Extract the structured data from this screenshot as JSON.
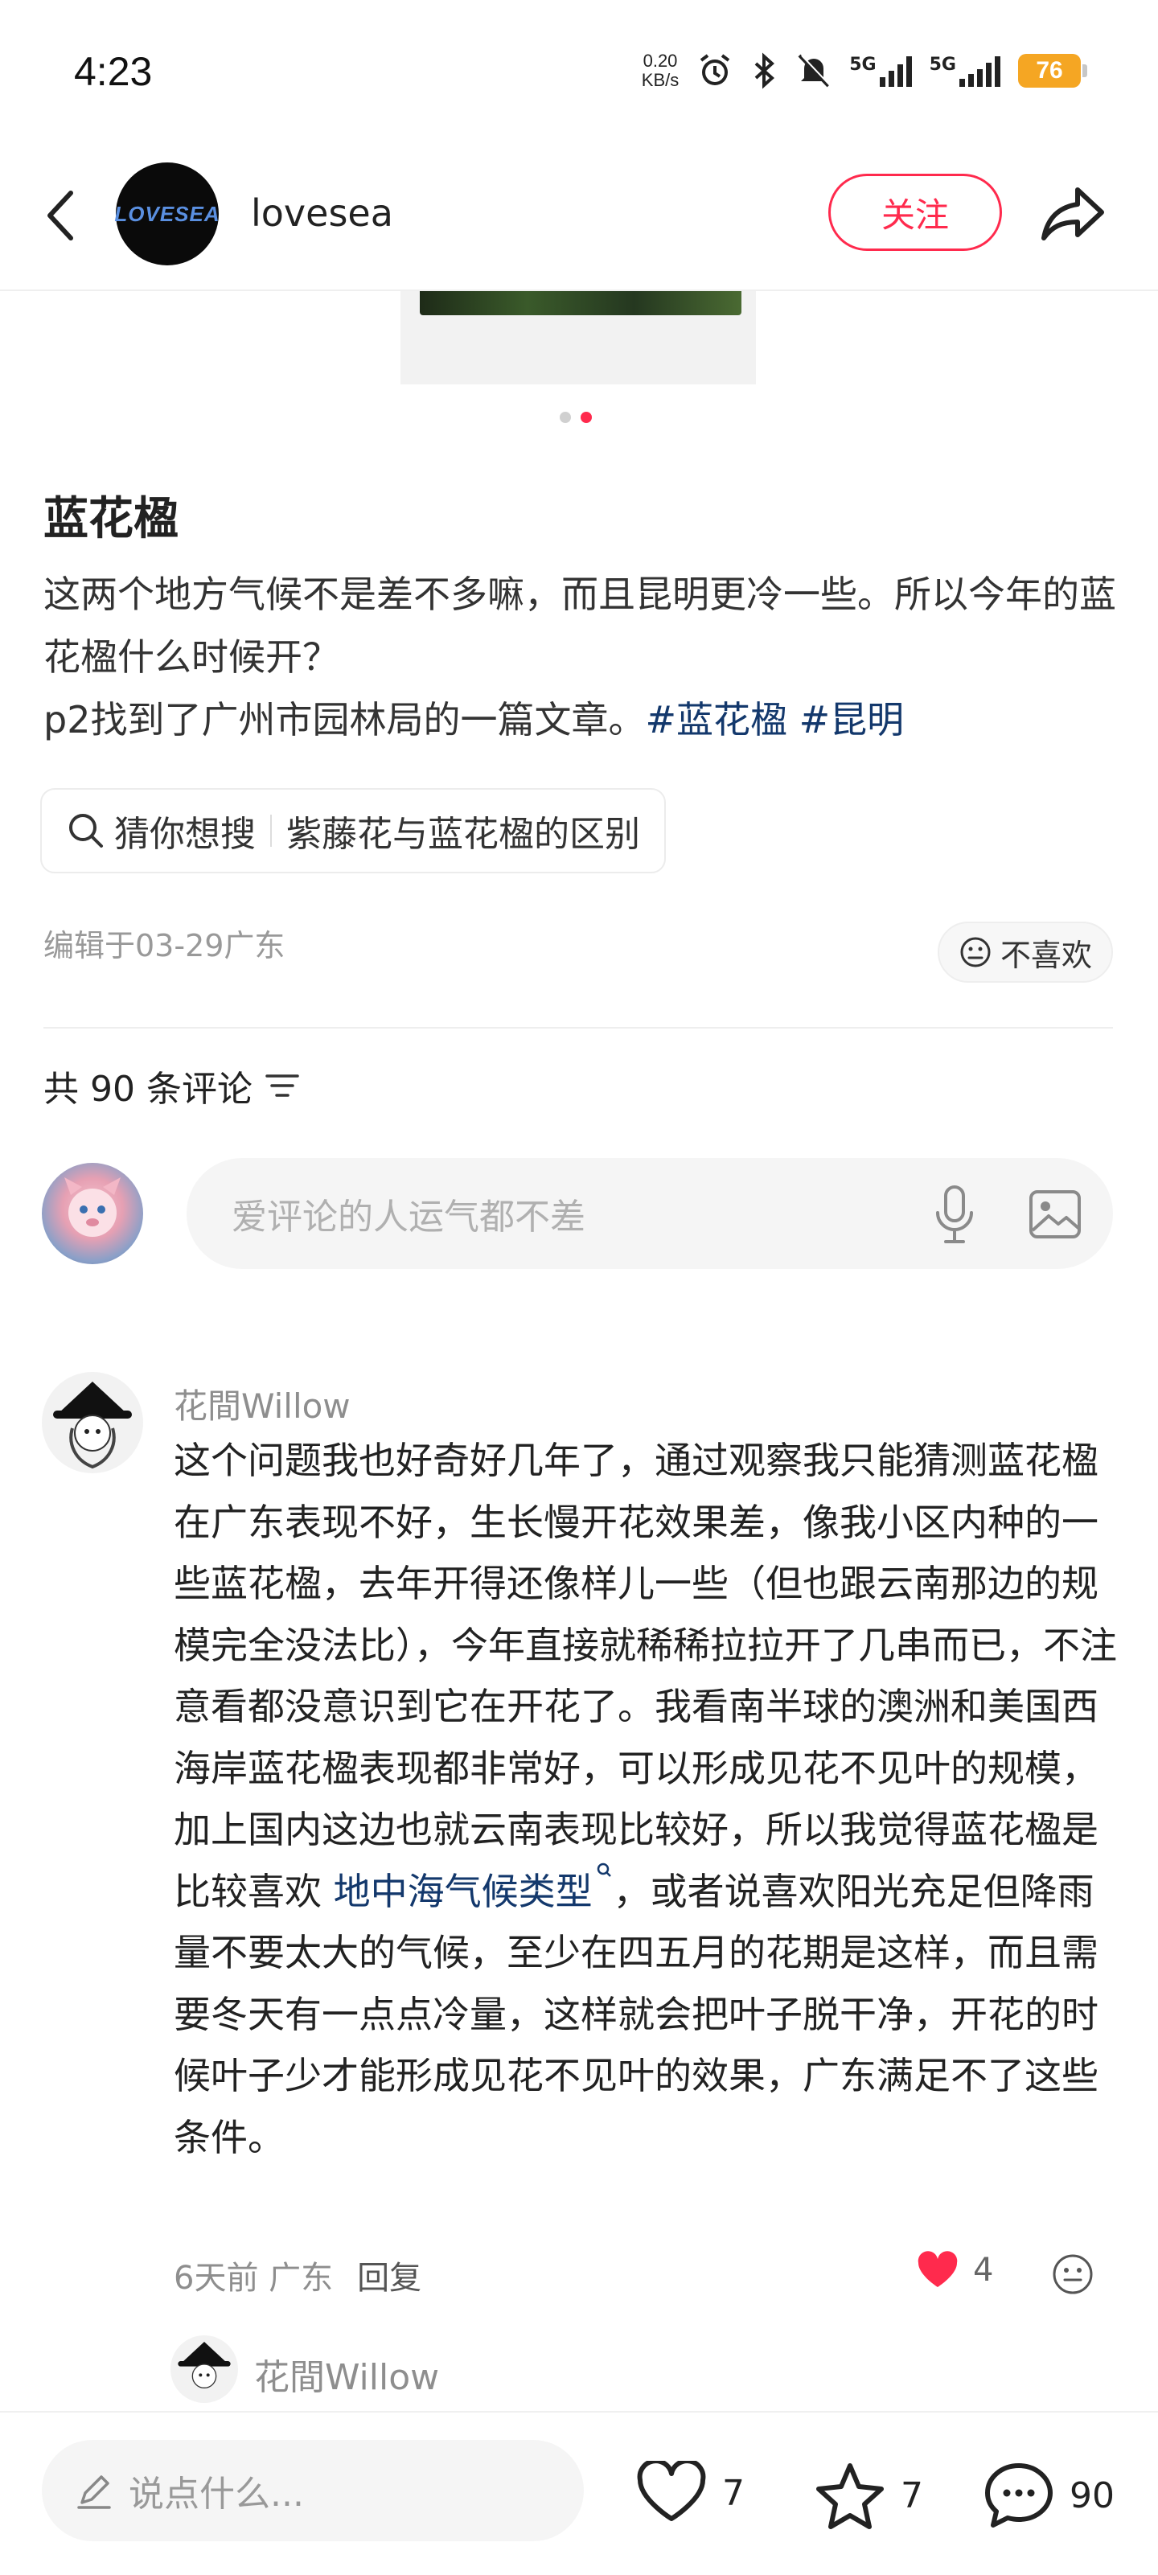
{
  "status": {
    "time": "4:23",
    "net_speed_value": "0.20",
    "net_speed_unit": "KB/s",
    "sim1": "5G",
    "sim2": "5G",
    "battery": "76"
  },
  "header": {
    "logo_text": "LOVESEA",
    "author": "lovesea",
    "follow_label": "关注"
  },
  "post": {
    "title": "蓝花楹",
    "body_line1": "这两个地方气候不是差不多嘛，而且昆明更冷一些。所以今年的蓝花楹什么时候开？",
    "body_line2": "p2找到了广州市园林局的一篇文章。",
    "hashtag1": "#蓝花楹",
    "hashtag2": "#昆明",
    "search_prefix": "猜你想搜",
    "search_term": "紫藤花与蓝花楹的区别",
    "edit_info": "编辑于03-29广东",
    "dislike_label": "不喜欢"
  },
  "comments_section": {
    "count_label": "共 90 条评论",
    "input_placeholder": "爱评论的人运气都不差"
  },
  "comment": {
    "author": "花間Willow",
    "text_before_link": "这个问题我也好奇好几年了，通过观察我只能猜测蓝花楹在广东表现不好，生长慢开花效果差，像我小区内种的一些蓝花楹，去年开得还像样儿一些（但也跟云南那边的规模完全没法比），今年直接就稀稀拉拉开了几串而已，不注意看都没意识到它在开花了。我看南半球的澳洲和美国西海岸蓝花楹表现都非常好，可以形成见花不见叶的规模，加上国内这边也就云南表现比较好，所以我觉得蓝花楹是比较喜欢 ",
    "link_text": "地中海气候类型",
    "text_after_link": "，或者说喜欢阳光充足但降雨量不要太大的气候，至少在四五月的花期是这样，而且需要冬天有一点点冷量，这样就会把叶子脱干净，开花的时候叶子少才能形成见花不见叶的效果，广东满足不了这些条件。",
    "time": "6天前",
    "location": "广东",
    "reply_label": "回复",
    "likes": "4"
  },
  "reply_preview": {
    "author": "花間Willow"
  },
  "bottom_bar": {
    "say_placeholder": "说点什么...",
    "likes": "7",
    "collects": "7",
    "comments": "90"
  },
  "colors": {
    "accent": "#ff2a4d",
    "link": "#13386c",
    "muted": "#8e8e8e"
  }
}
